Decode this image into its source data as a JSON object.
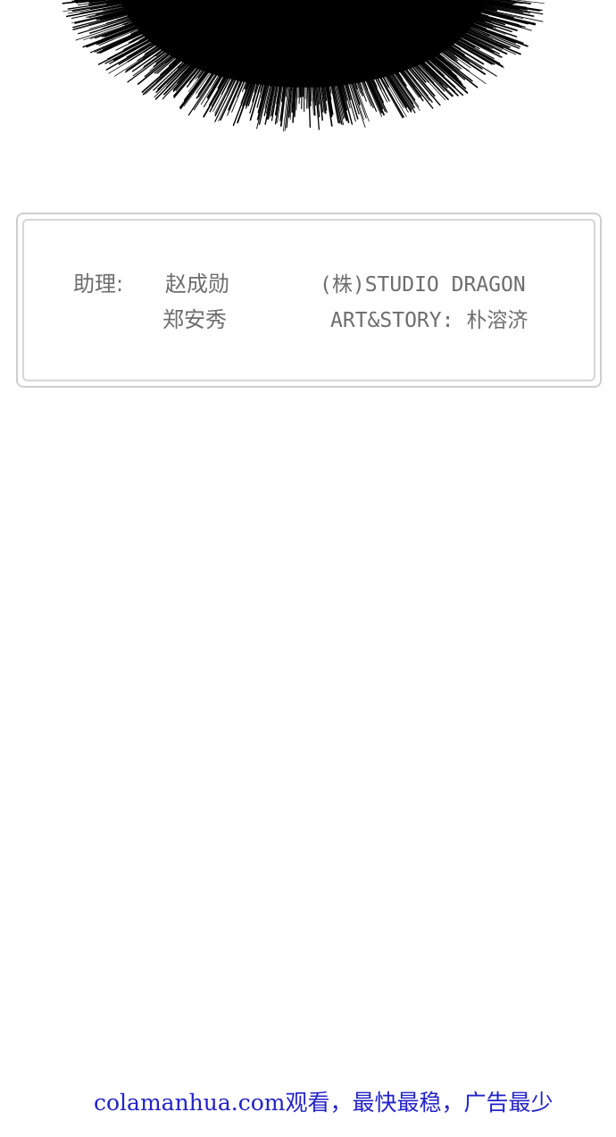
{
  "credits": {
    "assistant_label": "助理:",
    "assistant_name_1": "赵成勋",
    "assistant_name_2": "郑安秀",
    "studio": "(株)STUDIO DRAGON",
    "art_story": "ART&STORY: 朴溶济"
  },
  "footer": {
    "source_note": "colamanhua.com观看，最快最稳，广告最少"
  },
  "colors": {
    "background": "#ffffff",
    "burst": "#000000",
    "credit_text": "#6e6e6e",
    "frame_border": "#cfcfcf",
    "footer_link": "#2323c8"
  }
}
